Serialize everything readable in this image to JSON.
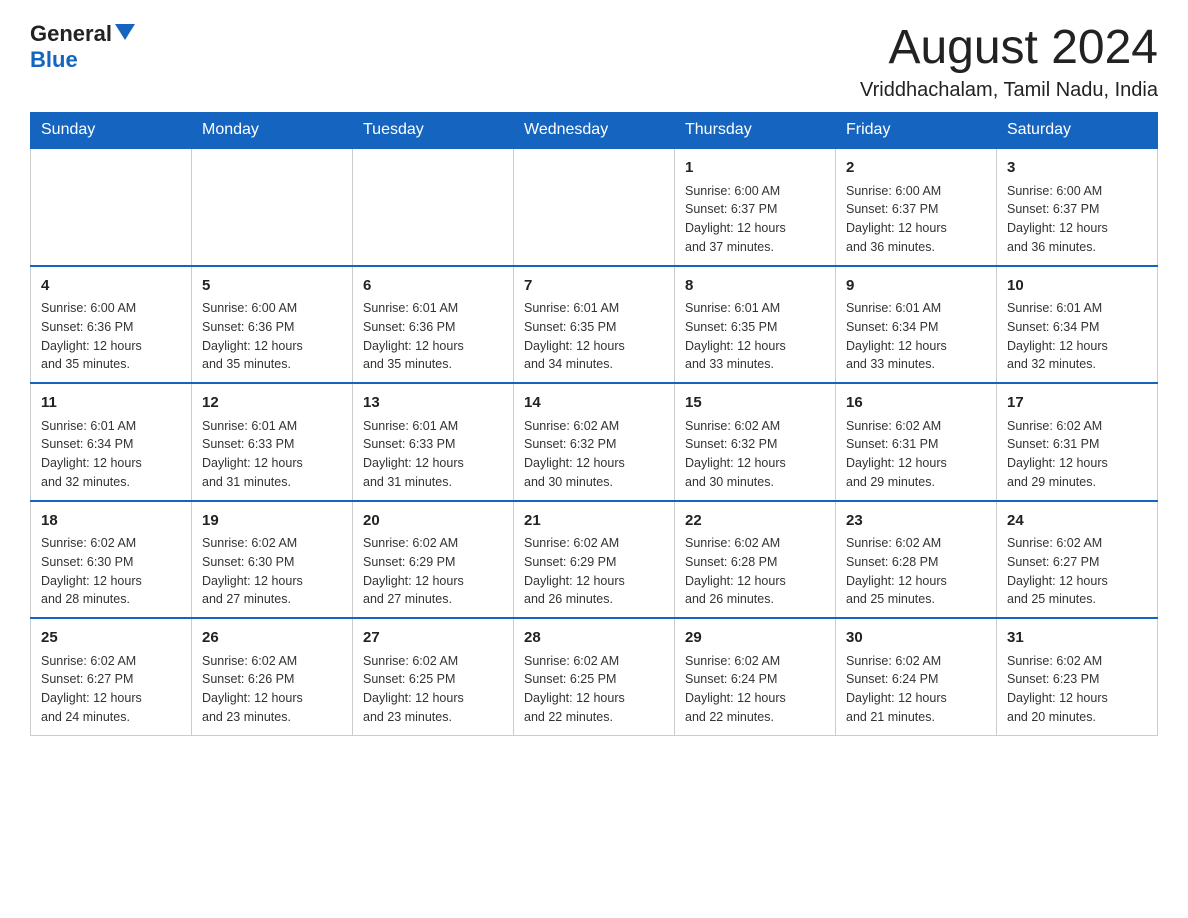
{
  "header": {
    "logo_general": "General",
    "logo_blue": "Blue",
    "month_title": "August 2024",
    "location": "Vriddhachalam, Tamil Nadu, India"
  },
  "days_of_week": [
    "Sunday",
    "Monday",
    "Tuesday",
    "Wednesday",
    "Thursday",
    "Friday",
    "Saturday"
  ],
  "weeks": [
    [
      {
        "day": "",
        "info": ""
      },
      {
        "day": "",
        "info": ""
      },
      {
        "day": "",
        "info": ""
      },
      {
        "day": "",
        "info": ""
      },
      {
        "day": "1",
        "info": "Sunrise: 6:00 AM\nSunset: 6:37 PM\nDaylight: 12 hours\nand 37 minutes."
      },
      {
        "day": "2",
        "info": "Sunrise: 6:00 AM\nSunset: 6:37 PM\nDaylight: 12 hours\nand 36 minutes."
      },
      {
        "day": "3",
        "info": "Sunrise: 6:00 AM\nSunset: 6:37 PM\nDaylight: 12 hours\nand 36 minutes."
      }
    ],
    [
      {
        "day": "4",
        "info": "Sunrise: 6:00 AM\nSunset: 6:36 PM\nDaylight: 12 hours\nand 35 minutes."
      },
      {
        "day": "5",
        "info": "Sunrise: 6:00 AM\nSunset: 6:36 PM\nDaylight: 12 hours\nand 35 minutes."
      },
      {
        "day": "6",
        "info": "Sunrise: 6:01 AM\nSunset: 6:36 PM\nDaylight: 12 hours\nand 35 minutes."
      },
      {
        "day": "7",
        "info": "Sunrise: 6:01 AM\nSunset: 6:35 PM\nDaylight: 12 hours\nand 34 minutes."
      },
      {
        "day": "8",
        "info": "Sunrise: 6:01 AM\nSunset: 6:35 PM\nDaylight: 12 hours\nand 33 minutes."
      },
      {
        "day": "9",
        "info": "Sunrise: 6:01 AM\nSunset: 6:34 PM\nDaylight: 12 hours\nand 33 minutes."
      },
      {
        "day": "10",
        "info": "Sunrise: 6:01 AM\nSunset: 6:34 PM\nDaylight: 12 hours\nand 32 minutes."
      }
    ],
    [
      {
        "day": "11",
        "info": "Sunrise: 6:01 AM\nSunset: 6:34 PM\nDaylight: 12 hours\nand 32 minutes."
      },
      {
        "day": "12",
        "info": "Sunrise: 6:01 AM\nSunset: 6:33 PM\nDaylight: 12 hours\nand 31 minutes."
      },
      {
        "day": "13",
        "info": "Sunrise: 6:01 AM\nSunset: 6:33 PM\nDaylight: 12 hours\nand 31 minutes."
      },
      {
        "day": "14",
        "info": "Sunrise: 6:02 AM\nSunset: 6:32 PM\nDaylight: 12 hours\nand 30 minutes."
      },
      {
        "day": "15",
        "info": "Sunrise: 6:02 AM\nSunset: 6:32 PM\nDaylight: 12 hours\nand 30 minutes."
      },
      {
        "day": "16",
        "info": "Sunrise: 6:02 AM\nSunset: 6:31 PM\nDaylight: 12 hours\nand 29 minutes."
      },
      {
        "day": "17",
        "info": "Sunrise: 6:02 AM\nSunset: 6:31 PM\nDaylight: 12 hours\nand 29 minutes."
      }
    ],
    [
      {
        "day": "18",
        "info": "Sunrise: 6:02 AM\nSunset: 6:30 PM\nDaylight: 12 hours\nand 28 minutes."
      },
      {
        "day": "19",
        "info": "Sunrise: 6:02 AM\nSunset: 6:30 PM\nDaylight: 12 hours\nand 27 minutes."
      },
      {
        "day": "20",
        "info": "Sunrise: 6:02 AM\nSunset: 6:29 PM\nDaylight: 12 hours\nand 27 minutes."
      },
      {
        "day": "21",
        "info": "Sunrise: 6:02 AM\nSunset: 6:29 PM\nDaylight: 12 hours\nand 26 minutes."
      },
      {
        "day": "22",
        "info": "Sunrise: 6:02 AM\nSunset: 6:28 PM\nDaylight: 12 hours\nand 26 minutes."
      },
      {
        "day": "23",
        "info": "Sunrise: 6:02 AM\nSunset: 6:28 PM\nDaylight: 12 hours\nand 25 minutes."
      },
      {
        "day": "24",
        "info": "Sunrise: 6:02 AM\nSunset: 6:27 PM\nDaylight: 12 hours\nand 25 minutes."
      }
    ],
    [
      {
        "day": "25",
        "info": "Sunrise: 6:02 AM\nSunset: 6:27 PM\nDaylight: 12 hours\nand 24 minutes."
      },
      {
        "day": "26",
        "info": "Sunrise: 6:02 AM\nSunset: 6:26 PM\nDaylight: 12 hours\nand 23 minutes."
      },
      {
        "day": "27",
        "info": "Sunrise: 6:02 AM\nSunset: 6:25 PM\nDaylight: 12 hours\nand 23 minutes."
      },
      {
        "day": "28",
        "info": "Sunrise: 6:02 AM\nSunset: 6:25 PM\nDaylight: 12 hours\nand 22 minutes."
      },
      {
        "day": "29",
        "info": "Sunrise: 6:02 AM\nSunset: 6:24 PM\nDaylight: 12 hours\nand 22 minutes."
      },
      {
        "day": "30",
        "info": "Sunrise: 6:02 AM\nSunset: 6:24 PM\nDaylight: 12 hours\nand 21 minutes."
      },
      {
        "day": "31",
        "info": "Sunrise: 6:02 AM\nSunset: 6:23 PM\nDaylight: 12 hours\nand 20 minutes."
      }
    ]
  ]
}
